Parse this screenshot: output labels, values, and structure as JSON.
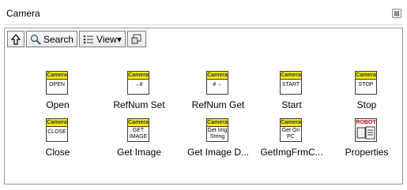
{
  "window": {
    "title": "Camera",
    "close_label": "⊠"
  },
  "toolbar": {
    "up_icon": "up-arrow-icon",
    "search_label": "Search",
    "view_label": "View▾",
    "pin_icon": "pin-icon"
  },
  "items": [
    {
      "name": "Open",
      "band": "Camera",
      "text": "OPEN"
    },
    {
      "name": "RefNum Set",
      "band": "Camera",
      "text": "→#"
    },
    {
      "name": "RefNum Get",
      "band": "Camera",
      "text": "#→"
    },
    {
      "name": "Start",
      "band": "Camera",
      "text": "START"
    },
    {
      "name": "Stop",
      "band": "Camera",
      "text": "STOP"
    },
    {
      "name": "Close",
      "band": "Camera",
      "text": "CLOSE"
    },
    {
      "name": "Get Image",
      "band": "Camera",
      "text": "GET IMAGE"
    },
    {
      "name": "Get Image D...",
      "band": "Camera",
      "text": "Get Img String"
    },
    {
      "name": "GetImgFrmC...",
      "band": "Camera",
      "text": "Get On PC"
    },
    {
      "name": "Properties",
      "band": "ROBOT ▸",
      "text": ""
    }
  ],
  "colors": {
    "band": "#f7e814"
  }
}
